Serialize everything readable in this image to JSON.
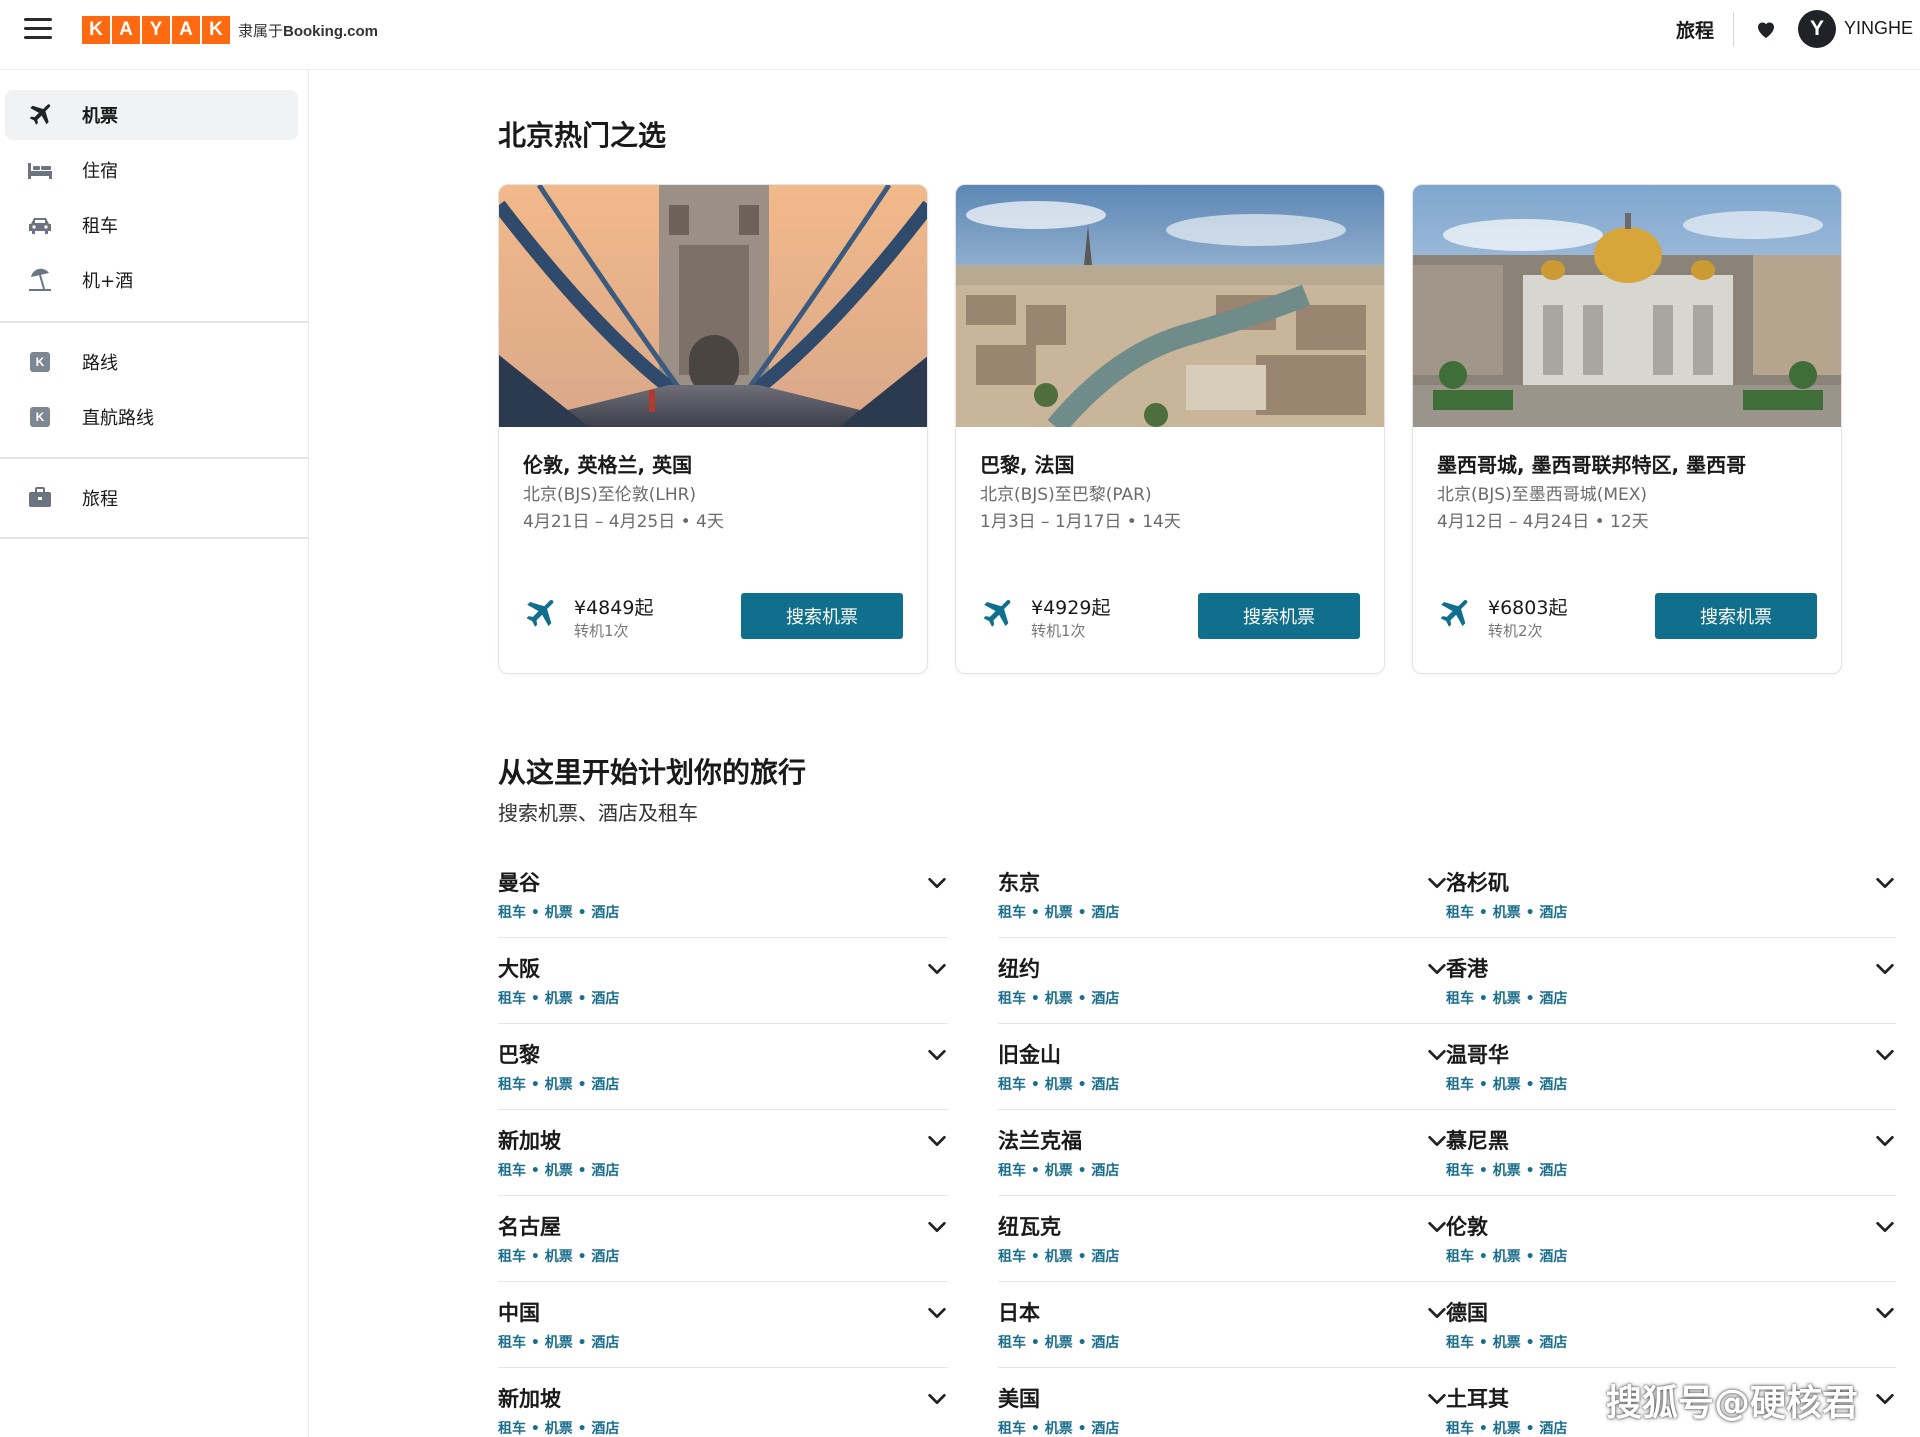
{
  "header": {
    "logo_letters": [
      "K",
      "A",
      "Y",
      "A",
      "K"
    ],
    "logo_sub_prefix": "隶属于",
    "logo_sub_brand": "Booking.com",
    "trips_label": "旅程",
    "avatar_initial": "Y",
    "username": "YINGHE"
  },
  "sidebar": {
    "items": [
      {
        "label": "机票",
        "icon": "plane-icon",
        "active": true
      },
      {
        "label": "住宿",
        "icon": "bed-icon"
      },
      {
        "label": "租车",
        "icon": "car-icon"
      },
      {
        "label": "机+酒",
        "icon": "beach-umbrella-icon"
      },
      {
        "label": "路线",
        "icon": "kayak-k-icon"
      },
      {
        "label": "直航路线",
        "icon": "kayak-k-icon"
      },
      {
        "label": "旅程",
        "icon": "briefcase-icon"
      }
    ]
  },
  "popular": {
    "title": "北京热门之选",
    "cards": [
      {
        "title": "伦敦, 英格兰, 英国",
        "route": "北京(BJS)至伦敦(LHR)",
        "dates": "4月21日 – 4月25日 • 4天",
        "price": "¥4849起",
        "stops": "转机1次",
        "button": "搜索机票"
      },
      {
        "title": "巴黎, 法国",
        "route": "北京(BJS)至巴黎(PAR)",
        "dates": "1月3日 – 1月17日 • 14天",
        "price": "¥4929起",
        "stops": "转机1次",
        "button": "搜索机票"
      },
      {
        "title": "墨西哥城, 墨西哥联邦特区, 墨西哥",
        "route": "北京(BJS)至墨西哥城(MEX)",
        "dates": "4月12日 – 4月24日 • 12天",
        "price": "¥6803起",
        "stops": "转机2次",
        "button": "搜索机票"
      }
    ]
  },
  "plan": {
    "title": "从这里开始计划你的旅行",
    "subtitle": "搜索机票、酒店及租车",
    "links_text": "租车 • 机票 • 酒店",
    "columns": [
      [
        "曼谷",
        "大阪",
        "巴黎",
        "新加坡",
        "名古屋",
        "中国",
        "新加坡"
      ],
      [
        "东京",
        "纽约",
        "旧金山",
        "法兰克福",
        "纽瓦克",
        "日本",
        "美国"
      ],
      [
        "洛杉矶",
        "香港",
        "温哥华",
        "慕尼黑",
        "伦敦",
        "德国",
        "土耳其"
      ]
    ]
  },
  "watermark": "搜狐号@硬核君",
  "colors": {
    "brand_orange": "#ff690f",
    "button_teal": "#0f6f8c",
    "link_teal": "#1b6e8c"
  }
}
